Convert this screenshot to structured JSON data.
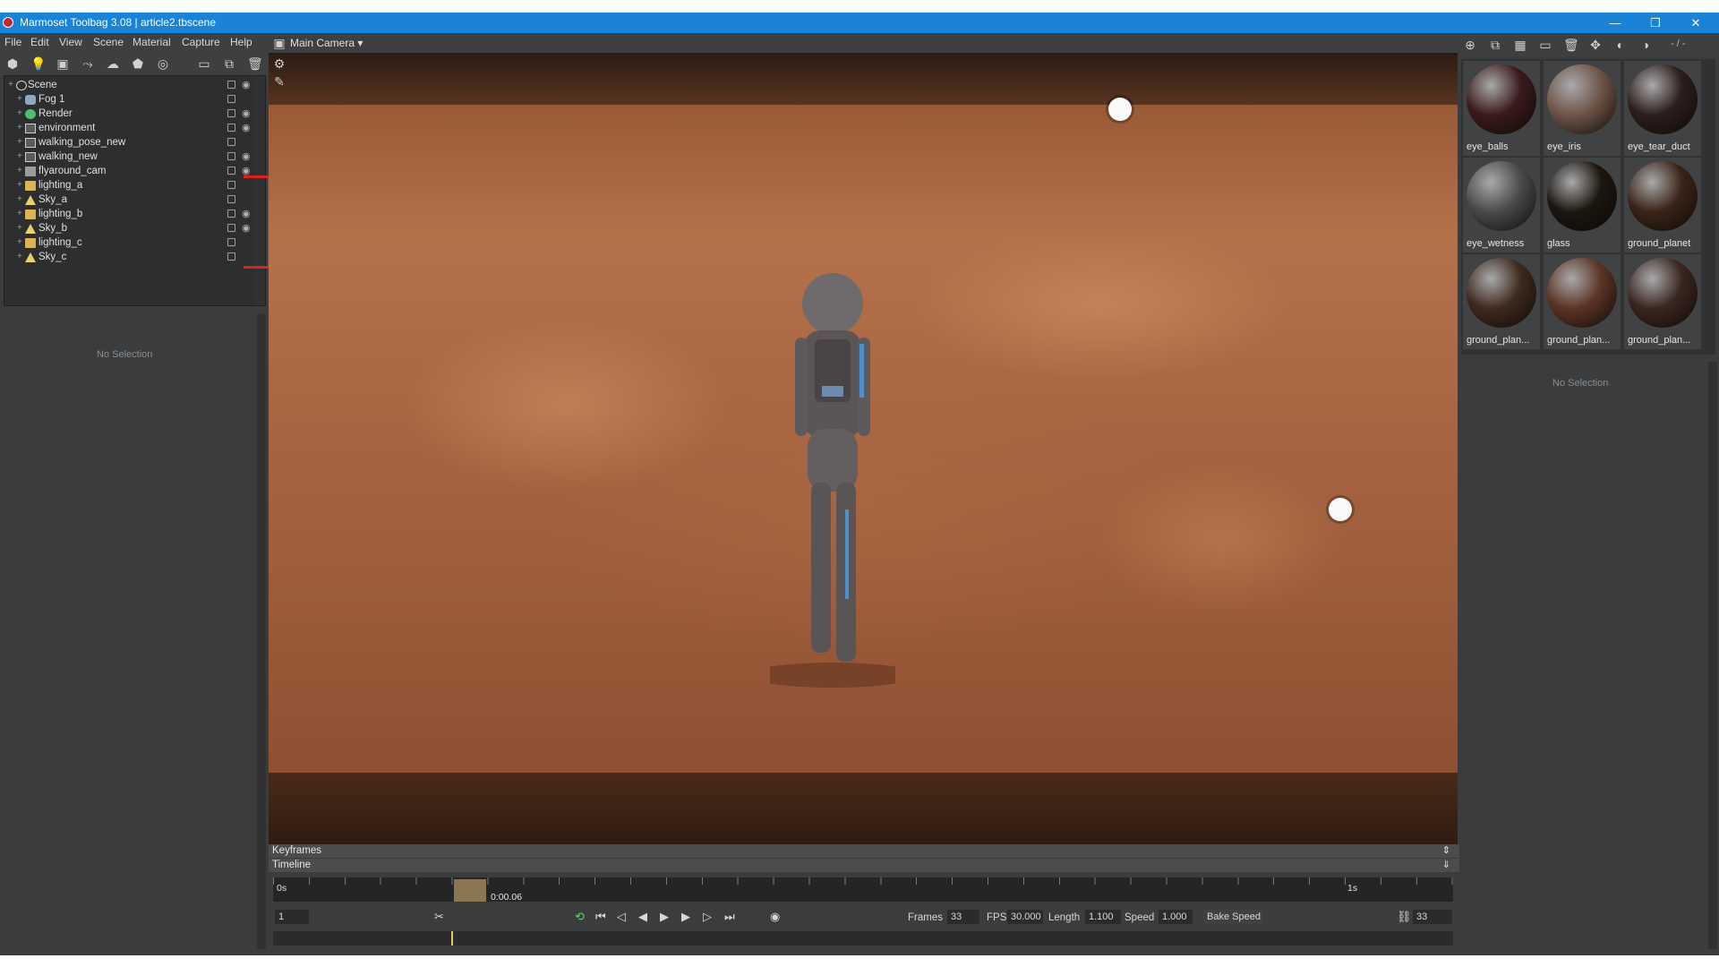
{
  "window": {
    "title": "Marmoset Toolbag 3.08  |  article2.tbscene",
    "minimize": "—",
    "restore": "❐",
    "close": "✕"
  },
  "menu": [
    "File",
    "Edit",
    "View",
    "Scene",
    "Material",
    "Capture",
    "Help"
  ],
  "scene_tree": [
    {
      "label": "Scene",
      "icon": "scene",
      "eye": true
    },
    {
      "label": "Fog 1",
      "icon": "fog",
      "eye": false
    },
    {
      "label": "Render",
      "icon": "render",
      "eye": true
    },
    {
      "label": "environment",
      "icon": "obj",
      "eye": true
    },
    {
      "label": "walking_pose_new",
      "icon": "obj",
      "eye": false
    },
    {
      "label": "walking_new",
      "icon": "obj",
      "eye": true
    },
    {
      "label": "flyaround_cam",
      "icon": "cam",
      "eye": true
    },
    {
      "label": "lighting_a",
      "icon": "folder",
      "eye": false
    },
    {
      "label": "Sky_a",
      "icon": "sky",
      "eye": false
    },
    {
      "label": "lighting_b",
      "icon": "folder",
      "eye": true
    },
    {
      "label": "Sky_b",
      "icon": "sky",
      "eye": true
    },
    {
      "label": "lighting_c",
      "icon": "folder",
      "eye": false
    },
    {
      "label": "Sky_c",
      "icon": "sky",
      "eye": false
    }
  ],
  "left_props": {
    "no_selection": "No Selection"
  },
  "viewport": {
    "camera": "Main Camera ▾"
  },
  "timeline": {
    "keyframes_label": "Keyframes",
    "timeline_label": "Timeline",
    "start_label": "0s",
    "end_label": "1s",
    "current_time": "0:00.06",
    "current_frame": "1",
    "frames_label": "Frames",
    "frames_value": "33",
    "fps_label": "FPS",
    "fps_value": "30.000",
    "length_label": "Length",
    "length_value": "1.100",
    "speed_label": "Speed",
    "speed_value": "1.000",
    "bake_speed": "Bake Speed",
    "link_value": "33"
  },
  "materials": [
    {
      "name": "eye_balls",
      "color": "#3a1a1c"
    },
    {
      "name": "eye_iris",
      "color": "#6e5548"
    },
    {
      "name": "eye_tear_duct",
      "color": "#2c1e1c"
    },
    {
      "name": "eye_wetness",
      "color": "#4a4a4c"
    },
    {
      "name": "glass",
      "color": "#1c1610"
    },
    {
      "name": "ground_planet",
      "color": "#3a2418"
    },
    {
      "name": "ground_plan...",
      "color": "#3e2a1e"
    },
    {
      "name": "ground_plan...",
      "color": "#5a3424"
    },
    {
      "name": "ground_plan...",
      "color": "#3a2620"
    }
  ],
  "mat_toolbar": {
    "page_indicator": "- / -"
  },
  "right_props": {
    "no_selection": "No Selection"
  }
}
